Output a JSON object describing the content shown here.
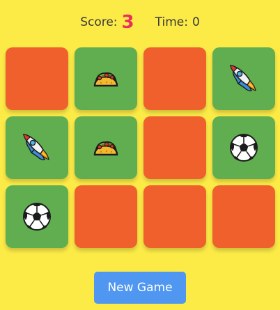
{
  "hud": {
    "score_label": "Score:",
    "score_value": "3",
    "time_label": "Time:",
    "time_value": "0"
  },
  "colors": {
    "background": "#fcea47",
    "card_hidden": "#f0602c",
    "card_revealed": "#60ae50",
    "score_value": "#e8305a",
    "button": "#4f97f0"
  },
  "board": {
    "columns": 4,
    "cards": [
      {
        "state": "hidden",
        "icon": ""
      },
      {
        "state": "revealed",
        "icon": "taco"
      },
      {
        "state": "hidden",
        "icon": ""
      },
      {
        "state": "revealed",
        "icon": "rocket"
      },
      {
        "state": "revealed",
        "icon": "rocket"
      },
      {
        "state": "revealed",
        "icon": "taco"
      },
      {
        "state": "hidden",
        "icon": ""
      },
      {
        "state": "revealed",
        "icon": "soccer-ball"
      },
      {
        "state": "revealed",
        "icon": "soccer-ball"
      },
      {
        "state": "hidden",
        "icon": ""
      },
      {
        "state": "hidden",
        "icon": ""
      },
      {
        "state": "hidden",
        "icon": ""
      }
    ]
  },
  "new_game_label": "New Game"
}
